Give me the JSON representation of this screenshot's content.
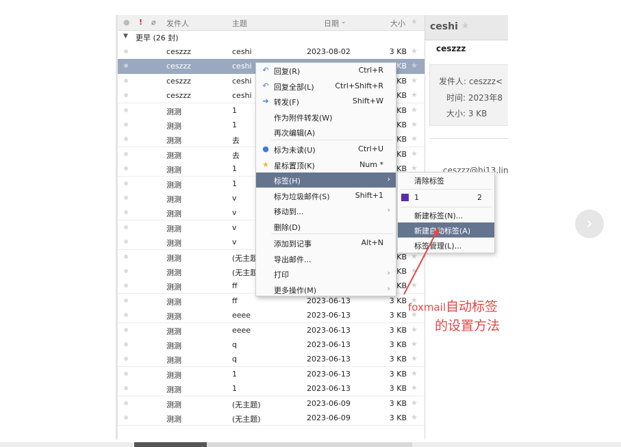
{
  "columns": {
    "sender": "发件人",
    "subject": "主题",
    "date": "日期",
    "size": "大小"
  },
  "group_label": "更早 (26 封)",
  "rows": [
    {
      "sender": "ceszzz",
      "subject": "ceshi",
      "date": "2023-08-02",
      "size": "3 KB"
    },
    {
      "sender": "ceszzz",
      "subject": "ceshi",
      "date": "",
      "size": "KB"
    },
    {
      "sender": "ceszzz",
      "subject": "ceshi",
      "date": "",
      "size": "KB"
    },
    {
      "sender": "ceszzz",
      "subject": "ceshi",
      "date": "",
      "size": "KB"
    },
    {
      "sender": "测测",
      "subject": "1",
      "date": "",
      "size": "KB"
    },
    {
      "sender": "测测",
      "subject": "1",
      "date": "",
      "size": "KB"
    },
    {
      "sender": "测测",
      "subject": "去",
      "date": "",
      "size": "KB"
    },
    {
      "sender": "测测",
      "subject": "去",
      "date": "",
      "size": "KB"
    },
    {
      "sender": "测测",
      "subject": "1",
      "date": "",
      "size": "KB"
    },
    {
      "sender": "测测",
      "subject": "1",
      "date": "",
      "size": ""
    },
    {
      "sender": "测测",
      "subject": "v",
      "date": "",
      "size": ""
    },
    {
      "sender": "测测",
      "subject": "v",
      "date": "",
      "size": ""
    },
    {
      "sender": "测测",
      "subject": "v",
      "date": "",
      "size": ""
    },
    {
      "sender": "测测",
      "subject": "v",
      "date": "",
      "size": ""
    },
    {
      "sender": "测测",
      "subject": "(无主题",
      "date": "",
      "size": "KB"
    },
    {
      "sender": "测测",
      "subject": "(无主题",
      "date": "",
      "size": "KB"
    },
    {
      "sender": "测测",
      "subject": "ff",
      "date": "",
      "size": "KB"
    },
    {
      "sender": "测测",
      "subject": "ff",
      "date": "2023-06-13",
      "size": "3 KB"
    },
    {
      "sender": "测测",
      "subject": "eeee",
      "date": "2023-06-13",
      "size": "3 KB"
    },
    {
      "sender": "测测",
      "subject": "eeee",
      "date": "2023-06-13",
      "size": "3 KB"
    },
    {
      "sender": "测测",
      "subject": "q",
      "date": "2023-06-13",
      "size": "3 KB"
    },
    {
      "sender": "测测",
      "subject": "q",
      "date": "2023-06-13",
      "size": "3 KB"
    },
    {
      "sender": "测测",
      "subject": "1",
      "date": "2023-06-13",
      "size": "3 KB"
    },
    {
      "sender": "测测",
      "subject": "1",
      "date": "2023-06-13",
      "size": "3 KB"
    },
    {
      "sender": "测测",
      "subject": "(无主题)",
      "date": "2023-06-09",
      "size": "3 KB"
    },
    {
      "sender": "测测",
      "subject": "(无主题)",
      "date": "2023-06-09",
      "size": "3 KB"
    }
  ],
  "reading_pane": {
    "title": "ceshi",
    "subject": "ceszzz",
    "from_label": "发件人: ceszzz<",
    "time_label": "时间: 2023年8",
    "size_label": "大小: 3 KB",
    "address": "ceszzz@hi13.lin"
  },
  "context_menu": [
    {
      "label": "回复(R)",
      "shortcut": "Ctrl+R",
      "icon": "reply-icon"
    },
    {
      "label": "回复全部(L)",
      "shortcut": "Ctrl+Shift+R",
      "icon": "reply-all-icon"
    },
    {
      "label": "转发(F)",
      "shortcut": "Shift+W",
      "icon": "forward-icon"
    },
    {
      "label": "作为附件转发(W)",
      "shortcut": ""
    },
    {
      "label": "再次编辑(A)",
      "shortcut": ""
    },
    {
      "label": "标为未读(U)",
      "shortcut": "Ctrl+U",
      "icon": "unread-dot-icon"
    },
    {
      "label": "星标置顶(K)",
      "shortcut": "Num *",
      "icon": "star-icon"
    },
    {
      "label": "标签(H)",
      "shortcut": "",
      "submenu": true
    },
    {
      "label": "标为垃圾邮件(S)",
      "shortcut": "Shift+1"
    },
    {
      "label": "移动到...",
      "shortcut": "",
      "submenu": true
    },
    {
      "label": "删除(D)",
      "shortcut": ""
    },
    {
      "label": "添加到记事",
      "shortcut": "Alt+N"
    },
    {
      "label": "导出邮件...",
      "shortcut": ""
    },
    {
      "label": "打印",
      "shortcut": "",
      "submenu": true
    },
    {
      "label": "更多操作(M)",
      "shortcut": "",
      "submenu": true
    }
  ],
  "tag_submenu": {
    "clear": "清除标签",
    "tag_name": "1",
    "tag_number": "2",
    "tag_color": "#5a2ea8",
    "new_tag": "新建标签(N)...",
    "new_auto_tag": "新建自动标签(A)",
    "manage": "标签管理(L)..."
  },
  "annotation": {
    "line1_latin": "foxmail",
    "line1_cjk": "自动标签",
    "line2": "的设置方法",
    "color": "#e84545"
  },
  "next_arrow": "›"
}
